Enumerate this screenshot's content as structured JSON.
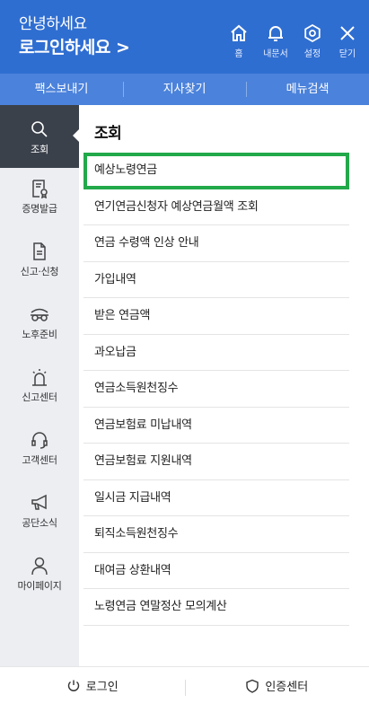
{
  "header": {
    "greeting": "안녕하세요",
    "login_link": "로그인하세요 >",
    "icons": [
      {
        "name": "home-icon",
        "label": "홈"
      },
      {
        "name": "bell-icon",
        "label": "내문서"
      },
      {
        "name": "gear-icon",
        "label": "설정"
      },
      {
        "name": "close-icon",
        "label": "닫기"
      }
    ]
  },
  "subnav": [
    "팩스보내기",
    "지사찾기",
    "메뉴검색"
  ],
  "sidebar": [
    {
      "name": "search-icon",
      "label": "조회",
      "active": true
    },
    {
      "name": "certificate-icon",
      "label": "증명발급"
    },
    {
      "name": "document-icon",
      "label": "신고·신청"
    },
    {
      "name": "glasses-icon",
      "label": "노후준비"
    },
    {
      "name": "lamp-icon",
      "label": "신고센터"
    },
    {
      "name": "headset-icon",
      "label": "고객센터"
    },
    {
      "name": "megaphone-icon",
      "label": "공단소식"
    },
    {
      "name": "person-icon",
      "label": "마이페이지"
    }
  ],
  "main": {
    "title": "조회",
    "items": [
      "예상노령연금",
      "연기연금신청자 예상연금월액 조회",
      "연금 수령액 인상 안내",
      "가입내역",
      "받은 연금액",
      "과오납금",
      "연금소득원천징수",
      "연금보험료 미납내역",
      "연금보험료 지원내역",
      "일시금 지급내역",
      "퇴직소득원천징수",
      "대여금 상환내역",
      "노령연금 연말정산 모의계산"
    ]
  },
  "footer": {
    "login": "로그인",
    "cert_center": "인증센터"
  },
  "colors": {
    "header_bg": "#2f6ed1",
    "subnav_bg": "#4b82db",
    "sidebar_bg": "#eceef2",
    "sidebar_active": "#3b414b",
    "highlight_border": "#22a94a"
  }
}
